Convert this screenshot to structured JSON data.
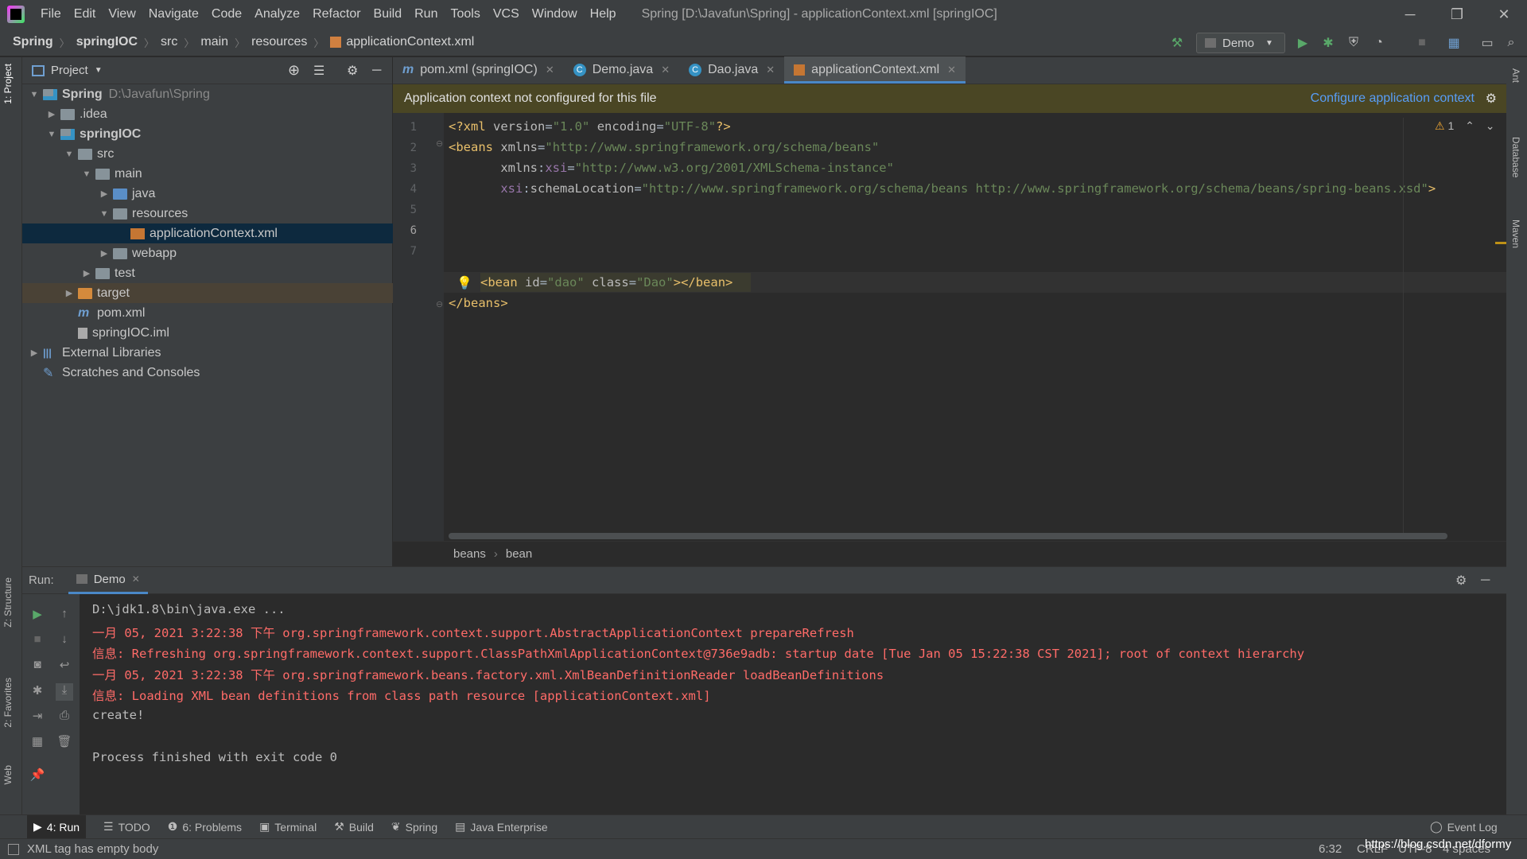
{
  "window": {
    "title": "Spring [D:\\Javafun\\Spring] - applicationContext.xml [springIOC]"
  },
  "menu": [
    "File",
    "Edit",
    "View",
    "Navigate",
    "Code",
    "Analyze",
    "Refactor",
    "Build",
    "Run",
    "Tools",
    "VCS",
    "Window",
    "Help"
  ],
  "breadcrumb": [
    "Spring",
    "springIOC",
    "src",
    "main",
    "resources",
    "applicationContext.xml"
  ],
  "run_config": {
    "name": "Demo"
  },
  "project": {
    "header": "Project",
    "tree": [
      {
        "label": "Spring",
        "extra": "D:\\Javafun\\Spring",
        "depth": 0,
        "arrow": "open",
        "icon": "module"
      },
      {
        "label": ".idea",
        "depth": 1,
        "arrow": "closed",
        "icon": "folder"
      },
      {
        "label": "springIOC",
        "depth": 1,
        "arrow": "open",
        "icon": "module"
      },
      {
        "label": "src",
        "depth": 2,
        "arrow": "open",
        "icon": "folder"
      },
      {
        "label": "main",
        "depth": 3,
        "arrow": "open",
        "icon": "folder"
      },
      {
        "label": "java",
        "depth": 4,
        "arrow": "closed",
        "icon": "blue"
      },
      {
        "label": "resources",
        "depth": 4,
        "arrow": "open",
        "icon": "folder"
      },
      {
        "label": "applicationContext.xml",
        "depth": 5,
        "arrow": "none",
        "icon": "xml",
        "selected": true
      },
      {
        "label": "webapp",
        "depth": 4,
        "arrow": "closed",
        "icon": "folder"
      },
      {
        "label": "test",
        "depth": 3,
        "arrow": "closed",
        "icon": "folder"
      },
      {
        "label": "target",
        "depth": 2,
        "arrow": "closed",
        "icon": "orange",
        "target": true
      },
      {
        "label": "pom.xml",
        "depth": 2,
        "arrow": "none",
        "icon": "maven"
      },
      {
        "label": "springIOC.iml",
        "depth": 2,
        "arrow": "none",
        "icon": "file"
      },
      {
        "label": "External Libraries",
        "depth": 0,
        "arrow": "closed",
        "icon": "lib"
      },
      {
        "label": "Scratches and Consoles",
        "depth": 0,
        "arrow": "none",
        "icon": "scratch"
      }
    ]
  },
  "editor": {
    "tabs": [
      {
        "label": "pom.xml (springIOC)",
        "icon": "m"
      },
      {
        "label": "Demo.java",
        "icon": "c"
      },
      {
        "label": "Dao.java",
        "icon": "c"
      },
      {
        "label": "applicationContext.xml",
        "icon": "xml",
        "active": true
      }
    ],
    "banner": {
      "message": "Application context not configured for this file",
      "link": "Configure application context"
    },
    "warning_count": "1",
    "line_numbers": [
      "1",
      "2",
      "3",
      "4",
      "5",
      "6",
      "7"
    ],
    "code_breadcrumb": [
      "beans",
      "bean"
    ]
  },
  "run": {
    "label": "Run:",
    "tab": "Demo",
    "output": [
      {
        "text": "D:\\jdk1.8\\bin\\java.exe ...",
        "color": "#bbbbbb"
      },
      {
        "text": "一月 05, 2021 3:22:38 下午 org.springframework.context.support.AbstractApplicationContext prepareRefresh",
        "color": "#ff6b68"
      },
      {
        "text": "信息: Refreshing org.springframework.context.support.ClassPathXmlApplicationContext@736e9adb: startup date [Tue Jan 05 15:22:38 CST 2021]; root of context hierarchy",
        "color": "#ff6b68"
      },
      {
        "text": "一月 05, 2021 3:22:38 下午 org.springframework.beans.factory.xml.XmlBeanDefinitionReader loadBeanDefinitions",
        "color": "#ff6b68"
      },
      {
        "text": "信息: Loading XML bean definitions from class path resource [applicationContext.xml]",
        "color": "#ff6b68"
      },
      {
        "text": "create!",
        "color": "#bbbbbb"
      },
      {
        "text": "",
        "color": "#bbbbbb"
      },
      {
        "text": "Process finished with exit code 0",
        "color": "#bbbbbb"
      }
    ]
  },
  "bottom_tabs": [
    {
      "label": "4: Run",
      "icon": "▶",
      "active": true
    },
    {
      "label": "TODO",
      "icon": "☰"
    },
    {
      "label": "6: Problems",
      "icon": "❶"
    },
    {
      "label": "Terminal",
      "icon": "▣"
    },
    {
      "label": "Build",
      "icon": "⚒"
    },
    {
      "label": "Spring",
      "icon": "❦"
    },
    {
      "label": "Java Enterprise",
      "icon": "▤"
    }
  ],
  "event_log": "Event Log",
  "side_tabs": {
    "left_top": "1: Project",
    "left_structure": "Z: Structure",
    "left_favorites": "2: Favorites",
    "left_web": "Web",
    "right_ant": "Ant",
    "right_database": "Database",
    "right_maven": "Maven"
  },
  "status": {
    "message": "XML tag has empty body",
    "position": "6:32",
    "line_sep": "CRLF",
    "encoding": "UTF-8",
    "indent": "4 spaces",
    "watermark": "https://blog.csdn.net/dformy"
  }
}
